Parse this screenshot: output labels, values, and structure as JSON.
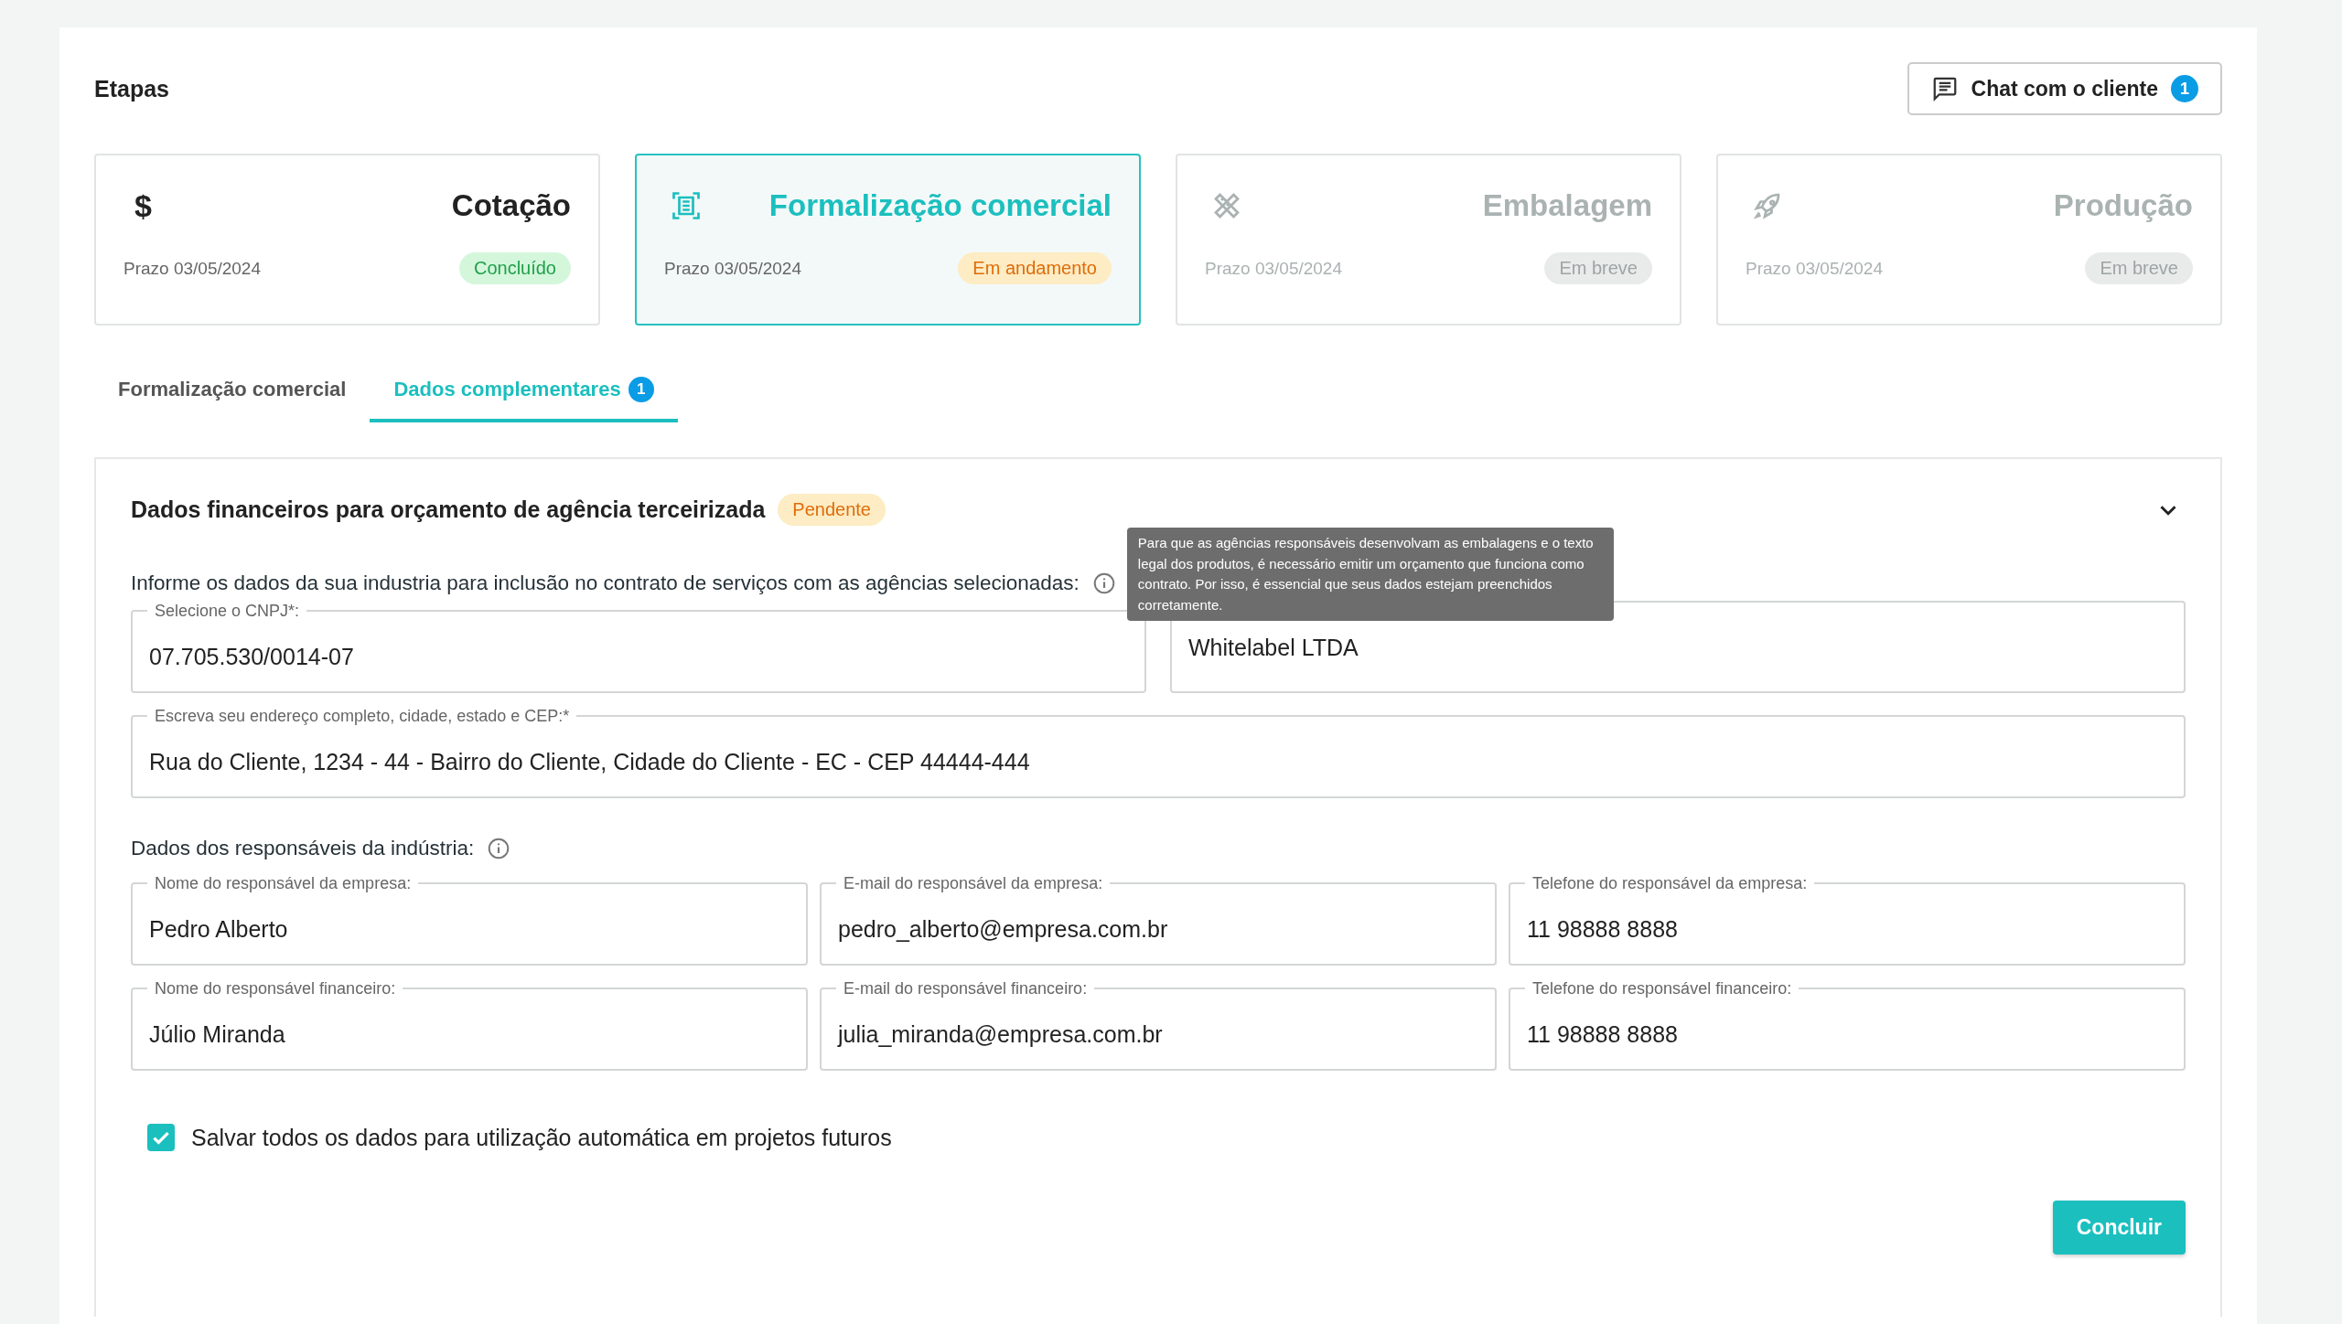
{
  "header": {
    "title": "Etapas",
    "chat_button": {
      "label": "Chat com o cliente",
      "badge": "1"
    }
  },
  "stages": [
    {
      "symbol": "$",
      "title": "Cotação",
      "deadline": "Prazo 03/05/2024",
      "status": "Concluído",
      "completed": true,
      "selected": false,
      "disabled": false
    },
    {
      "title": "Formalização comercial",
      "deadline": "Prazo 03/05/2024",
      "status": "Em andamento",
      "completed": false,
      "selected": true,
      "disabled": false
    },
    {
      "title": "Embalagem",
      "deadline": "Prazo 03/05/2024",
      "status": "Em breve",
      "completed": false,
      "selected": false,
      "disabled": true
    },
    {
      "title": "Produção",
      "deadline": "Prazo 03/05/2024",
      "status": "Em breve",
      "completed": false,
      "selected": false,
      "disabled": true
    }
  ],
  "tabs": [
    {
      "label": "Formalização comercial",
      "selected": false
    },
    {
      "label": "Dados complementares",
      "selected": true,
      "badge": "1"
    }
  ],
  "section": {
    "title": "Dados financeiros para orçamento de agência terceirizada",
    "status": "Pendente",
    "expanded": true,
    "intro": "Informe os dados da sua industria para inclusão no contrato de serviços com as agências selecionadas:",
    "tooltip": "Para que as agências responsáveis desenvolvam as embalagens e o texto legal dos produtos, é necessário emitir um orçamento que funciona como contrato. Por isso, é essencial que seus dados estejam preenchidos corretamente.",
    "company_fields": [
      {
        "label": "Selecione o CNPJ*:",
        "value": "07.705.530/0014-07"
      },
      {
        "value": "Whitelabel LTDA"
      }
    ],
    "address_field": {
      "label": "Escreva seu endereço completo, cidade, estado e CEP:*",
      "value": "Rua do Cliente, 1234 - 44 - Bairro do Cliente, Cidade do Cliente - EC - CEP 44444-444"
    },
    "responsibles_label": "Dados dos responsáveis da indústria:",
    "responsible_rows": [
      [
        {
          "label": "Nome do responsável da empresa:",
          "value": "Pedro Alberto"
        },
        {
          "label": "E-mail do responsável  da empresa:",
          "value": "pedro_alberto@empresa.com.br"
        },
        {
          "label": "Telefone do responsável  da empresa:",
          "value": "11 98888 8888"
        }
      ],
      [
        {
          "label": "Nome do responsável financeiro:",
          "value": "Júlio Miranda"
        },
        {
          "label": "E-mail do responsável financeiro:",
          "value": "julia_miranda@empresa.com.br"
        },
        {
          "label": "Telefone do responsável financeiro:",
          "value": "11 98888 8888"
        }
      ]
    ],
    "save_checkbox": {
      "label": "Salvar todos os dados para utilização automática em projetos futuros",
      "checked": true
    },
    "submit_button": "Concluir"
  }
}
